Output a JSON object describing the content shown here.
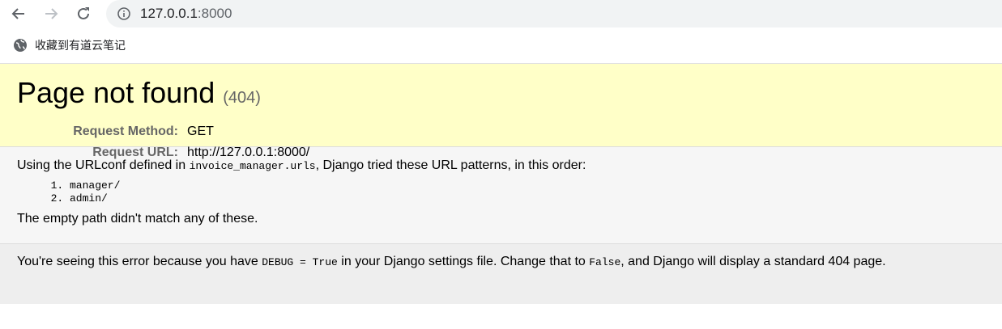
{
  "browser": {
    "url_host": "127.0.0.1",
    "url_port": ":8000",
    "bookmark_label": "收藏到有道云笔记"
  },
  "summary": {
    "title": "Page not found",
    "status_code": "(404)",
    "request_method_label": "Request Method:",
    "request_method_value": "GET",
    "request_url_label": "Request URL:",
    "request_url_value": "http://127.0.0.1:8000/"
  },
  "info": {
    "intro_prefix": "Using the URLconf defined in ",
    "urlconf": "invoice_manager.urls",
    "intro_suffix": ", Django tried these URL patterns, in this order:",
    "patterns": [
      "manager/",
      "admin/"
    ],
    "no_match": "The empty path didn't match any of these."
  },
  "explanation": {
    "part1": "You're seeing this error because you have ",
    "debug_code": "DEBUG = True",
    "part2": " in your Django settings file. Change that to ",
    "false_code": "False",
    "part3": ", and Django will display a standard 404 page."
  }
}
